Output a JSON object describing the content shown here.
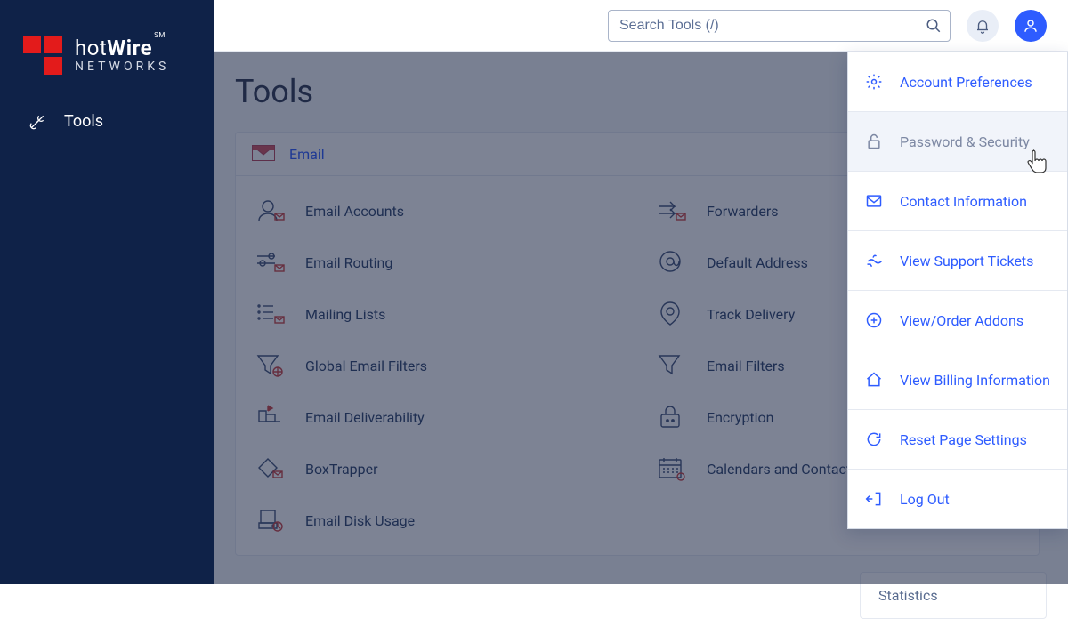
{
  "brand": {
    "name": "hotWire",
    "sub": "NETWORKS",
    "sm": "SM"
  },
  "sidebar": {
    "items": [
      {
        "label": "Tools"
      }
    ]
  },
  "search": {
    "placeholder": "Search Tools (/)"
  },
  "page": {
    "title": "Tools"
  },
  "panel": {
    "title": "Email"
  },
  "tools": {
    "left": [
      {
        "label": "Email Accounts"
      },
      {
        "label": "Email Routing"
      },
      {
        "label": "Mailing Lists"
      },
      {
        "label": "Global Email Filters"
      },
      {
        "label": "Email Deliverability"
      },
      {
        "label": "BoxTrapper"
      },
      {
        "label": "Email Disk Usage"
      }
    ],
    "right": [
      {
        "label": "Forwarders"
      },
      {
        "label": "Default Address"
      },
      {
        "label": "Track Delivery"
      },
      {
        "label": "Email Filters"
      },
      {
        "label": "Encryption"
      },
      {
        "label": "Calendars and Contacts"
      }
    ]
  },
  "dropdown": {
    "items": [
      {
        "label": "Account Preferences"
      },
      {
        "label": "Password & Security"
      },
      {
        "label": "Contact Information"
      },
      {
        "label": "View Support Tickets"
      },
      {
        "label": "View/Order Addons"
      },
      {
        "label": "View Billing Information"
      },
      {
        "label": "Reset Page Settings"
      },
      {
        "label": "Log Out"
      }
    ]
  },
  "stats": {
    "title": "Statistics"
  }
}
